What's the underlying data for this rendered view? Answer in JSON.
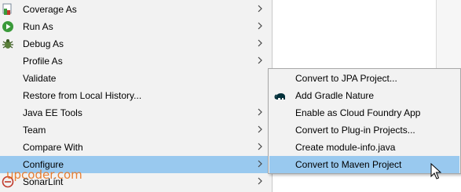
{
  "menu": {
    "items": [
      {
        "label": "Coverage As",
        "icon": "coverage-icon",
        "has_submenu": true
      },
      {
        "label": "Run As",
        "icon": "run-icon",
        "has_submenu": true
      },
      {
        "label": "Debug As",
        "icon": "debug-bug-icon",
        "has_submenu": true
      },
      {
        "label": "Profile As",
        "icon": "",
        "has_submenu": true
      },
      {
        "label": "Validate",
        "icon": "",
        "has_submenu": false
      },
      {
        "label": "Restore from Local History...",
        "icon": "",
        "has_submenu": false
      },
      {
        "label": "Java EE Tools",
        "icon": "",
        "has_submenu": true
      },
      {
        "label": "Team",
        "icon": "",
        "has_submenu": true
      },
      {
        "label": "Compare With",
        "icon": "",
        "has_submenu": true
      },
      {
        "label": "Configure",
        "icon": "",
        "has_submenu": true,
        "selected": true
      },
      {
        "label": "SonarLint",
        "icon": "sonarlint-icon",
        "has_submenu": true
      }
    ]
  },
  "submenu": {
    "items": [
      {
        "label": "Convert to JPA Project...",
        "icon": ""
      },
      {
        "label": "Add Gradle Nature",
        "icon": "gradle-elephant-icon"
      },
      {
        "label": "Enable as Cloud Foundry App",
        "icon": ""
      },
      {
        "label": "Convert to Plug-in Projects...",
        "icon": ""
      },
      {
        "label": "Create module-info.java",
        "icon": ""
      },
      {
        "label": "Convert to Maven Project",
        "icon": "",
        "selected": true
      }
    ]
  },
  "watermark": "upcoder.com",
  "colors": {
    "menu_bg": "#f2f2f2",
    "selection": "#99c9ef",
    "run_green": "#3a9a3a",
    "sonar_red": "#c0392b",
    "watermark": "#e8731e"
  }
}
